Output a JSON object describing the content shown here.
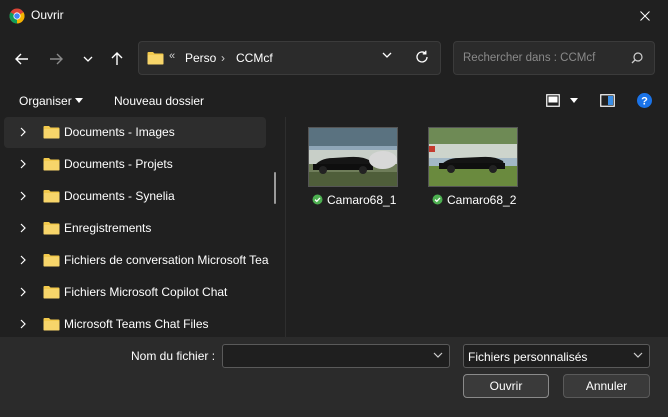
{
  "window": {
    "title": "Ouvrir",
    "icon": "chrome-icon"
  },
  "address_bar": {
    "overflow": "«",
    "crumbs": [
      "Perso",
      "CCMcf"
    ],
    "separator": "›"
  },
  "search": {
    "placeholder": "Rechercher dans : CCMcf"
  },
  "toolbar": {
    "organize_label": "Organiser",
    "new_folder_label": "Nouveau dossier"
  },
  "sidebar": {
    "items": [
      {
        "label": "Documents - Images",
        "selected": true
      },
      {
        "label": "Documents - Projets"
      },
      {
        "label": "Documents - Synelia"
      },
      {
        "label": "Enregistrements"
      },
      {
        "label": "Fichiers de conversation Microsoft Tea"
      },
      {
        "label": "Fichiers Microsoft Copilot Chat"
      },
      {
        "label": "Microsoft Teams Chat Files"
      }
    ]
  },
  "files": [
    {
      "name": "Camaro68_1",
      "status": "synced"
    },
    {
      "name": "Camaro68_2",
      "status": "synced"
    }
  ],
  "footer": {
    "filename_label": "Nom du fichier :",
    "filename_value": "",
    "filetype_value": "Fichiers personnalisés",
    "open_label": "Ouvrir",
    "cancel_label": "Annuler"
  },
  "colors": {
    "folder": "#f2c94c",
    "sync_ok": "#4caf50",
    "help": "#1a73e8"
  }
}
